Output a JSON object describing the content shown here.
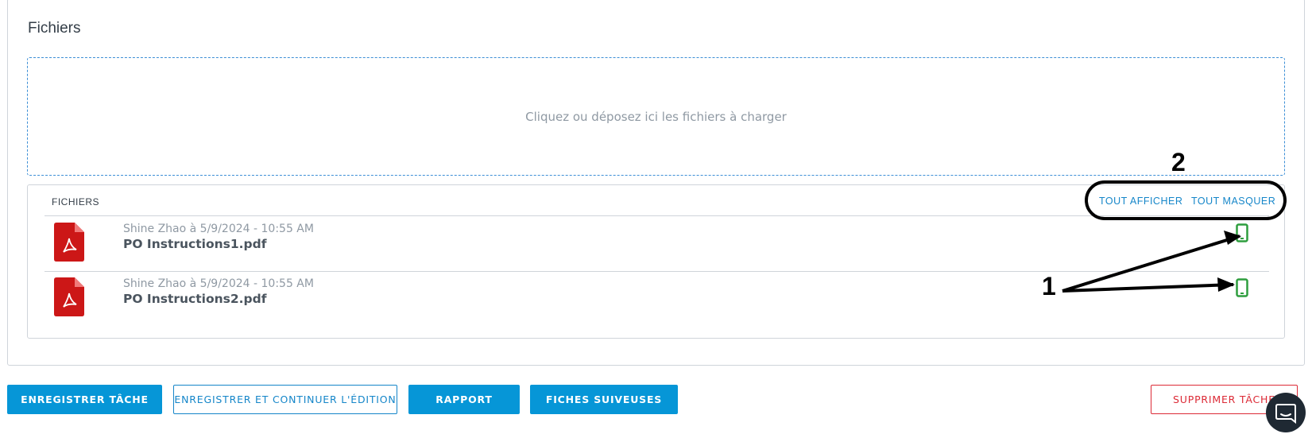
{
  "section": {
    "title": "Fichiers"
  },
  "dropzone": {
    "text": "Cliquez ou déposez ici les fichiers à charger"
  },
  "files": {
    "header": "FICHIERS",
    "show_all": "TOUT AFFICHER",
    "hide_all": "TOUT MASQUER",
    "items": [
      {
        "meta": "Shine Zhao à 5/9/2024 - 10:55 AM",
        "name": "PO Instructions1.pdf"
      },
      {
        "meta": "Shine Zhao à 5/9/2024 - 10:55 AM",
        "name": "PO Instructions2.pdf"
      }
    ]
  },
  "actions": {
    "save": "ENREGISTRER TÂCHE",
    "save_continue": "ENREGISTRER ET CONTINUER L'ÉDITION",
    "report": "RAPPORT",
    "followup": "FICHES SUIVEUSES",
    "delete": "SUPPRIMER TÂCHE"
  },
  "annotations": {
    "label_1": "1",
    "label_2": "2"
  },
  "colors": {
    "accent": "#0696d7",
    "link": "#1586c9",
    "danger": "#dc2a36",
    "pdf_red": "#cc1717",
    "mobile_green": "#2e9e3e"
  },
  "icons": {
    "file": "pdf-icon",
    "mobile": "mobile-phone-icon",
    "chat": "chat-bubble-icon"
  }
}
